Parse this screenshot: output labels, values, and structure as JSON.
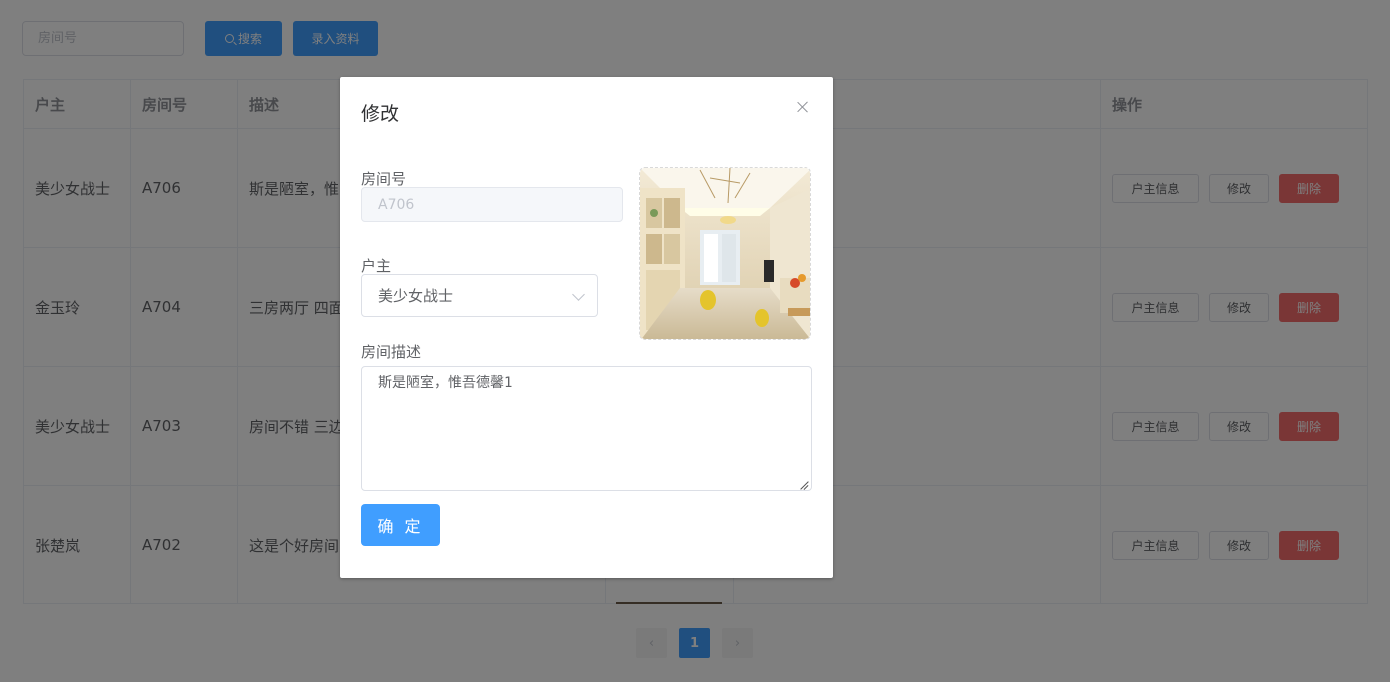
{
  "toolbar": {
    "search_placeholder": "房间号",
    "search_button": "搜索",
    "add_button": "录入资料"
  },
  "table": {
    "headers": {
      "owner": "户主",
      "room": "房间号",
      "desc": "描述",
      "ops": "操作"
    },
    "rows": [
      {
        "owner": "美少女战士",
        "room": "A706",
        "desc": "斯是陋室，惟"
      },
      {
        "owner": "金玉玲",
        "room": "A704",
        "desc": "三房两厅 四面"
      },
      {
        "owner": "美少女战士",
        "room": "A703",
        "desc": "房间不错 三边"
      },
      {
        "owner": "张楚岚",
        "room": "A702",
        "desc": "这是个好房间"
      }
    ],
    "actions": {
      "owner_info": "户主信息",
      "edit": "修改",
      "delete": "删除"
    }
  },
  "pagination": {
    "prev": "‹",
    "current": "1",
    "next": "›"
  },
  "dialog": {
    "title": "修改",
    "room_label": "房间号",
    "room_value": "A706",
    "owner_label": "户主",
    "owner_value": "美少女战士",
    "desc_label": "房间描述",
    "desc_value": "斯是陋室，惟吾德馨1",
    "confirm_button": "确 定"
  },
  "icons": {
    "close": "close-icon",
    "search": "search-icon",
    "dropdown": "chevron-down-icon"
  },
  "colors": {
    "primary": "#409eff",
    "danger": "#f56c6c",
    "border": "#ebeef5"
  }
}
